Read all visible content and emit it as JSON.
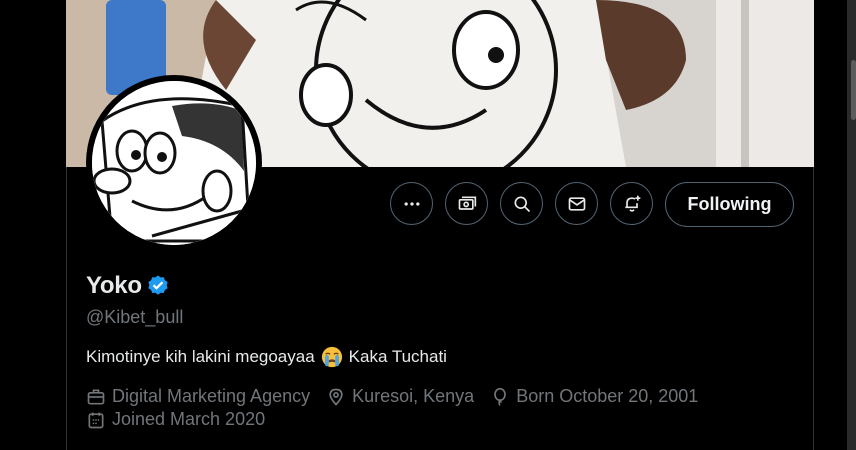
{
  "profile": {
    "display_name": "Yoko",
    "verified": true,
    "handle": "@Kibet_bull",
    "bio_text_before": "Kimotinye kih lakini megoayaa",
    "bio_emoji": "loudly-crying-face",
    "bio_text_after": "Kaka Tuchati",
    "meta": {
      "category": "Digital Marketing Agency",
      "location": "Kuresoi, Kenya",
      "birthday": "Born October 20, 2001",
      "joined": "Joined March 2020"
    }
  },
  "actions": {
    "more_icon": "more-horizontal-icon",
    "subscribe_icon": "money-icon",
    "search_icon": "search-icon",
    "message_icon": "envelope-icon",
    "notify_icon": "bell-plus-icon",
    "following_label": "Following"
  },
  "colors": {
    "background": "#000000",
    "border": "#536471",
    "secondary_text": "#71767b",
    "verified_blue": "#1d9bf0"
  }
}
